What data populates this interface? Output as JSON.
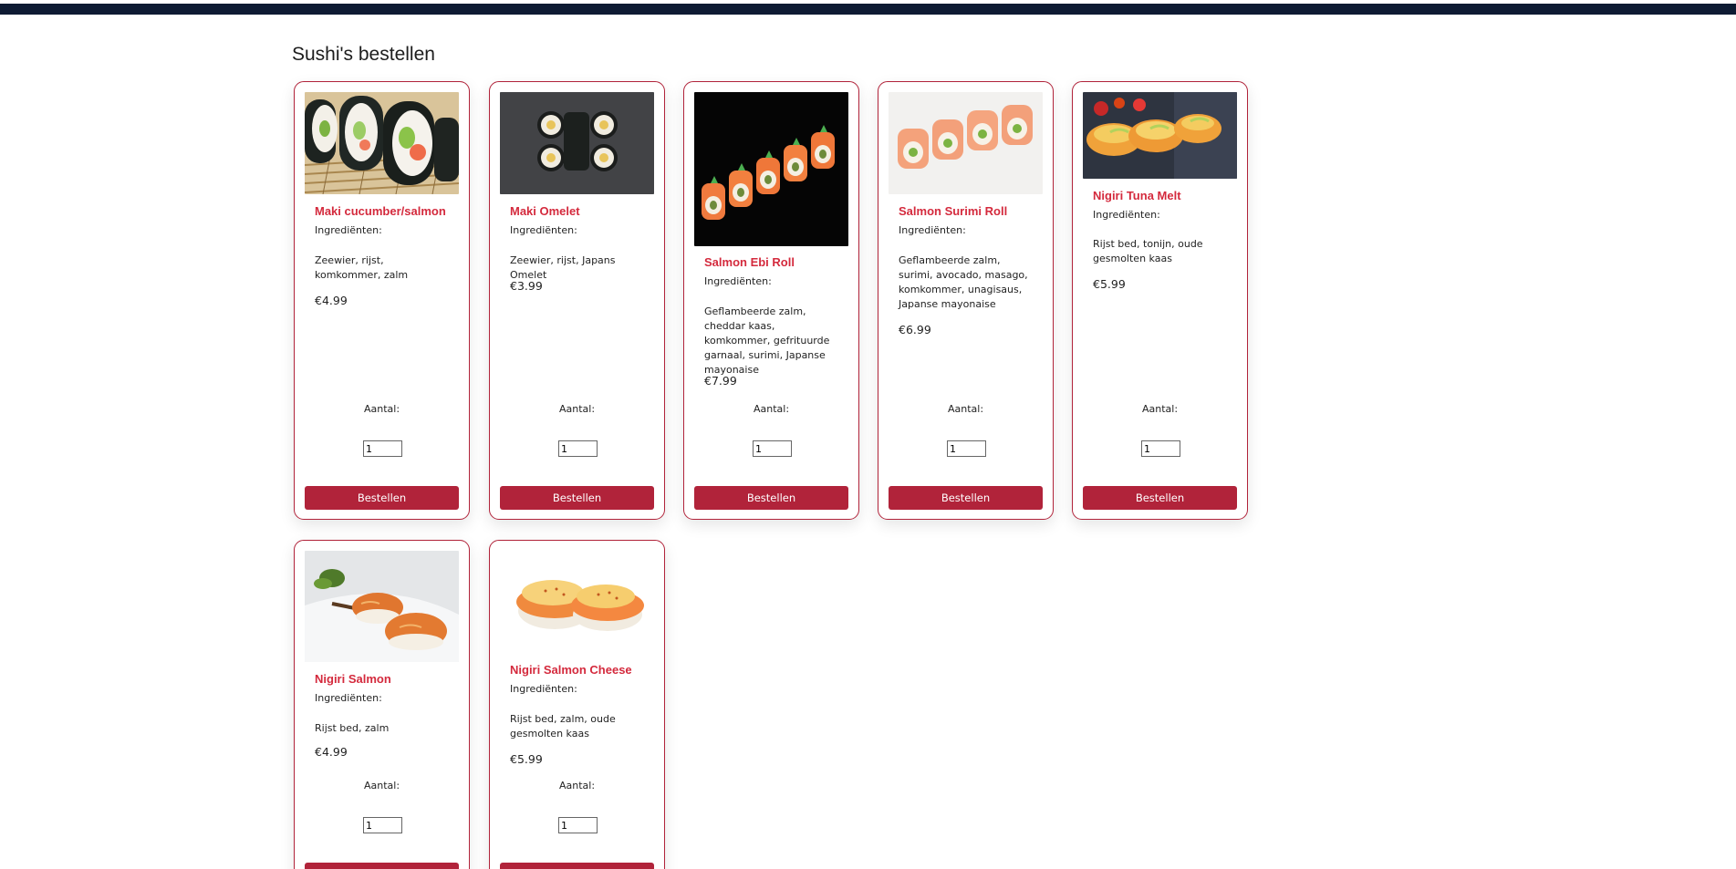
{
  "page": {
    "title": "Sushi's bestellen"
  },
  "labels": {
    "ingredients": "Ingrediënten:",
    "quantity": "Aantal:",
    "order_button": "Bestellen",
    "default_qty": "1"
  },
  "products": [
    {
      "name": "Maki cucumber/salmon",
      "ingredients": "Zeewier, rijst, komkommer, zalm",
      "price": "€4.99"
    },
    {
      "name": "Maki Omelet",
      "ingredients": "Zeewier, rijst, Japans Omelet",
      "price": "€3.99"
    },
    {
      "name": "Salmon Ebi Roll",
      "ingredients": "Geflambeerde zalm, cheddar kaas, komkommer, gefrituurde garnaal, surimi, Japanse mayonaise",
      "price": "€7.99"
    },
    {
      "name": "Salmon Surimi Roll",
      "ingredients": "Geflambeerde zalm, surimi, avocado, masago, komkommer, unagisaus, Japanse mayonaise",
      "price": "€6.99"
    },
    {
      "name": "Nigiri Tuna Melt",
      "ingredients": "Rijst bed, tonijn, oude gesmolten kaas",
      "price": "€5.99"
    },
    {
      "name": "Nigiri Salmon",
      "ingredients": "Rijst bed, zalm",
      "price": "€4.99"
    },
    {
      "name": "Nigiri Salmon Cheese",
      "ingredients": "Rijst bed, zalm, oude gesmolten kaas",
      "price": "€5.99"
    }
  ],
  "colors": {
    "accent": "#b1233a",
    "name_red": "#d42a3d",
    "topbar": "#0e1b33"
  }
}
